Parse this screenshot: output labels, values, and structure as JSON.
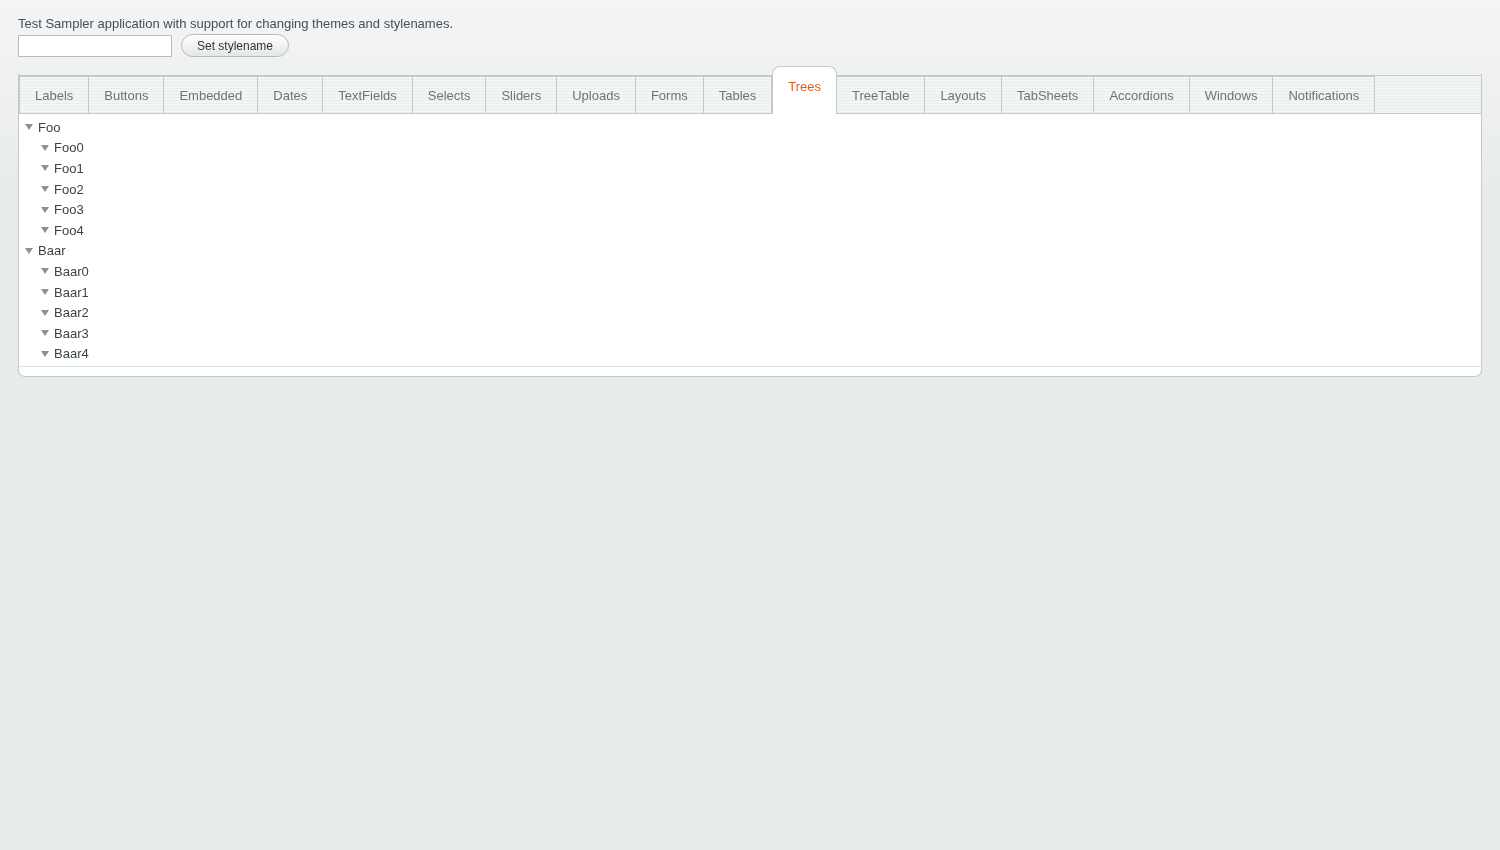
{
  "description": "Test Sampler application with support for changing themes and stylenames.",
  "set_button": {
    "label": "Set stylename"
  },
  "tabs": [
    {
      "label": "Labels",
      "selected": false
    },
    {
      "label": "Buttons",
      "selected": false
    },
    {
      "label": "Embedded",
      "selected": false
    },
    {
      "label": "Dates",
      "selected": false
    },
    {
      "label": "TextFields",
      "selected": false
    },
    {
      "label": "Selects",
      "selected": false
    },
    {
      "label": "Sliders",
      "selected": false
    },
    {
      "label": "Uploads",
      "selected": false
    },
    {
      "label": "Forms",
      "selected": false
    },
    {
      "label": "Tables",
      "selected": false
    },
    {
      "label": "Trees",
      "selected": true
    },
    {
      "label": "TreeTable",
      "selected": false
    },
    {
      "label": "Layouts",
      "selected": false
    },
    {
      "label": "TabSheets",
      "selected": false
    },
    {
      "label": "Accordions",
      "selected": false
    },
    {
      "label": "Windows",
      "selected": false
    },
    {
      "label": "Notifications",
      "selected": false
    }
  ],
  "tree": [
    {
      "label": "Foo",
      "expanded": true,
      "children": [
        {
          "label": "Foo0",
          "expanded": true
        },
        {
          "label": "Foo1",
          "expanded": true
        },
        {
          "label": "Foo2",
          "expanded": true
        },
        {
          "label": "Foo3",
          "expanded": true
        },
        {
          "label": "Foo4",
          "expanded": true
        }
      ]
    },
    {
      "label": "Baar",
      "expanded": true,
      "children": [
        {
          "label": "Baar0",
          "expanded": true
        },
        {
          "label": "Baar1",
          "expanded": true
        },
        {
          "label": "Baar2",
          "expanded": true
        },
        {
          "label": "Baar3",
          "expanded": true
        },
        {
          "label": "Baar4",
          "expanded": true
        }
      ]
    }
  ]
}
